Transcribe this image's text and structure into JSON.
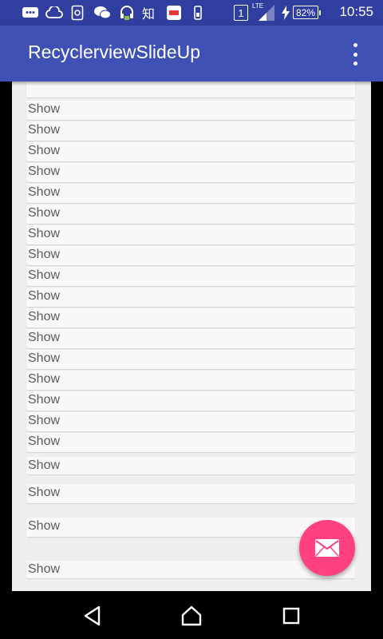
{
  "status_bar": {
    "time": "10:55",
    "battery": "82%",
    "sim_slot": "1",
    "network": "LTE",
    "zhihu": "知"
  },
  "app_bar": {
    "title": "RecyclerviewSlideUp",
    "menu_icon": "overflow-menu-icon"
  },
  "list": {
    "items": [
      {
        "label": "Show"
      },
      {
        "label": "Show"
      },
      {
        "label": "Show"
      },
      {
        "label": "Show"
      },
      {
        "label": "Show"
      },
      {
        "label": "Show"
      },
      {
        "label": "Show"
      },
      {
        "label": "Show"
      },
      {
        "label": "Show"
      },
      {
        "label": "Show"
      },
      {
        "label": "Show"
      },
      {
        "label": "Show"
      },
      {
        "label": "Show"
      },
      {
        "label": "Show"
      },
      {
        "label": "Show"
      },
      {
        "label": "Show"
      },
      {
        "label": "Show"
      },
      {
        "label": "Show"
      },
      {
        "label": "Show"
      },
      {
        "label": "Show"
      },
      {
        "label": "Show"
      }
    ]
  },
  "fab": {
    "icon": "mail-icon",
    "color": "#ff4081"
  },
  "nav_bar": {
    "back": "back-icon",
    "home": "home-icon",
    "recents": "recents-icon"
  },
  "colors": {
    "primary": "#3f51b5",
    "primary_dark": "#303f9f",
    "accent": "#ff4081"
  }
}
